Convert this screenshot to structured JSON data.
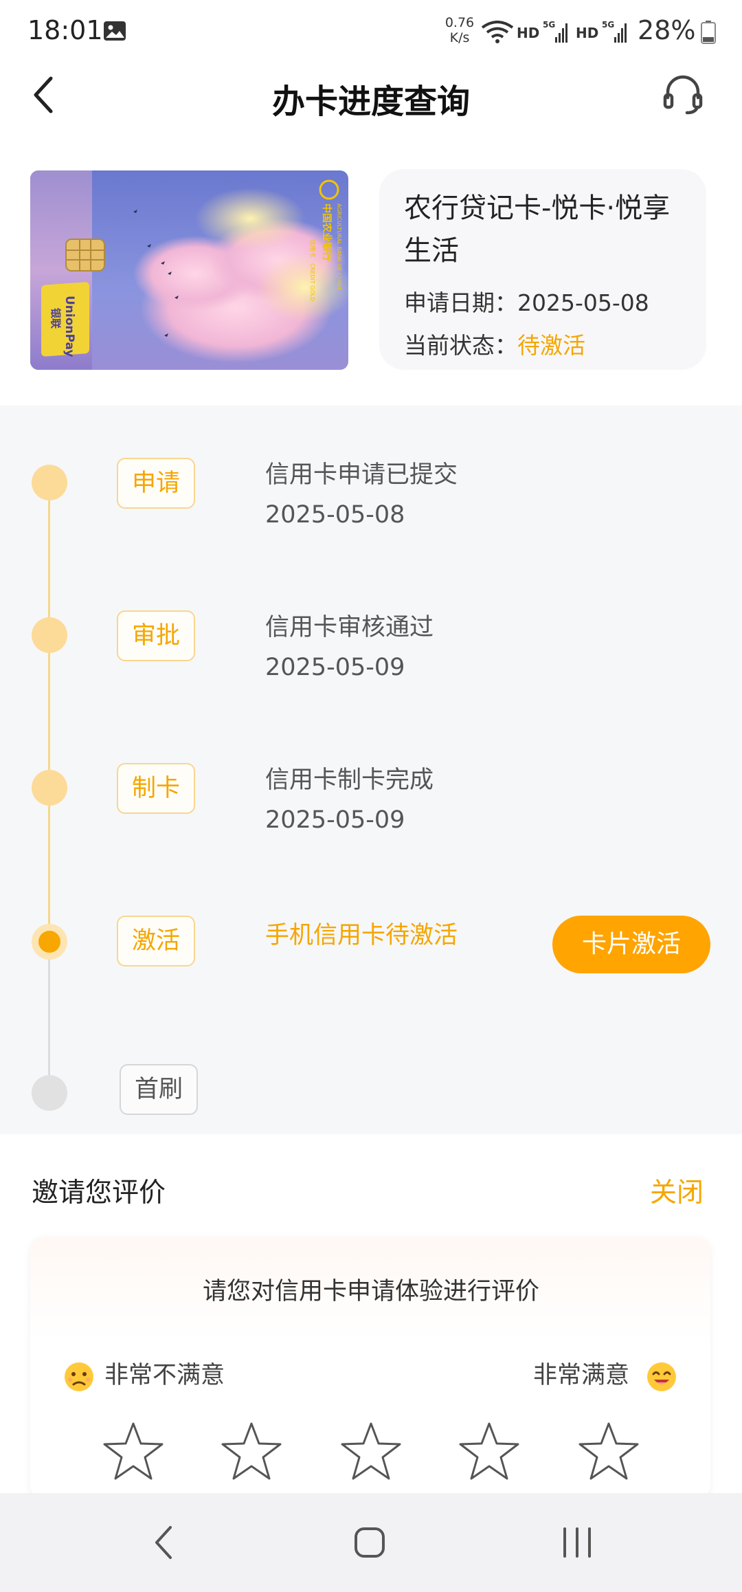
{
  "status_bar": {
    "time": "18:01",
    "net_speed_value": "0.76",
    "net_speed_unit": "K/s",
    "hd1": "HD",
    "hd2": "HD",
    "signal1_label": "5G",
    "signal2_label": "5G",
    "battery": "28%",
    "icons": [
      "gallery-icon",
      "wifi-icon",
      "signal-icon",
      "battery-icon"
    ]
  },
  "header": {
    "title": "办卡进度查询",
    "back_icon": "chevron-left-icon",
    "service_icon": "headset-icon"
  },
  "card": {
    "name": "农行贷记卡-悦卡·悦享生活",
    "apply_date_label": "申请日期：",
    "apply_date": "2025-05-08",
    "status_label": "当前状态：",
    "status_value": "待激活",
    "card_image_text": {
      "bank_cn": "中国农业银行",
      "bank_en": "AGRICULTURAL BANK OF CHINA",
      "card_type_cn": "信用卡",
      "card_type_en": "CREDIT GOLD",
      "unionpay_en": "UnionPay",
      "unionpay_cn": "银联"
    }
  },
  "timeline": {
    "steps": [
      {
        "tag": "申请",
        "desc": "信用卡申请已提交",
        "date": "2025-05-08",
        "state": "done"
      },
      {
        "tag": "审批",
        "desc": "信用卡审核通过",
        "date": "2025-05-09",
        "state": "done"
      },
      {
        "tag": "制卡",
        "desc": "信用卡制卡完成",
        "date": "2025-05-09",
        "state": "done"
      },
      {
        "tag": "激活",
        "desc": "手机信用卡待激活",
        "date": "",
        "state": "current"
      },
      {
        "tag": "首刷",
        "desc": "",
        "date": "",
        "state": "pending"
      }
    ],
    "activate_button": "卡片激活"
  },
  "review": {
    "title": "邀请您评价",
    "close": "关闭",
    "prompt": "请您对信用卡申请体验进行评价",
    "low_label": "非常不满意",
    "high_label": "非常满意",
    "stars_total": 5,
    "stars_selected": 0
  },
  "colors": {
    "accent": "#f5a600",
    "button": "#ffa400",
    "timeline_done": "#fcdb98",
    "timeline_pending": "#e1e1e1",
    "section_bg": "#f6f7f9"
  },
  "nav_bar": {
    "icons": [
      "back-nav-icon",
      "home-nav-icon",
      "recent-apps-icon"
    ]
  }
}
